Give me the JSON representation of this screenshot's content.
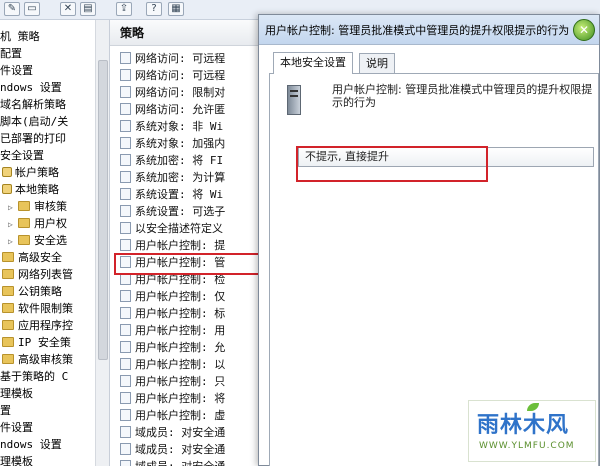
{
  "toolbar": {
    "icons": [
      "edit-icon",
      "document-icon",
      "delete-icon",
      "properties-icon",
      "export-icon",
      "help-icon",
      "view-icon"
    ]
  },
  "tree": {
    "items": [
      {
        "label": "机 策略",
        "type": "text"
      },
      {
        "label": "配置",
        "type": "text"
      },
      {
        "label": "件设置",
        "type": "text"
      },
      {
        "label": "ndows 设置",
        "type": "text"
      },
      {
        "label": "域名解析策略",
        "type": "text"
      },
      {
        "label": "脚本(启动/关",
        "type": "text"
      },
      {
        "label": "已部署的打印",
        "type": "text"
      },
      {
        "label": "安全设置",
        "type": "text"
      },
      {
        "label": "帐户策略",
        "type": "lock"
      },
      {
        "label": "本地策略",
        "type": "lock"
      },
      {
        "label": "审核策",
        "type": "folder-arrow"
      },
      {
        "label": "用户权",
        "type": "folder-arrow"
      },
      {
        "label": "安全选",
        "type": "folder-arrow"
      },
      {
        "label": "高级安全",
        "type": "folder"
      },
      {
        "label": "网络列表管",
        "type": "folder"
      },
      {
        "label": "公钥策略",
        "type": "folder"
      },
      {
        "label": "软件限制策",
        "type": "folder"
      },
      {
        "label": "应用程序控",
        "type": "folder"
      },
      {
        "label": "IP 安全策",
        "type": "folder"
      },
      {
        "label": "高级审核策",
        "type": "folder"
      },
      {
        "label": "基于策略的 C",
        "type": "text"
      },
      {
        "label": "理模板",
        "type": "text"
      },
      {
        "label": "置",
        "type": "text"
      },
      {
        "label": "件设置",
        "type": "text"
      },
      {
        "label": "ndows 设置",
        "type": "text"
      },
      {
        "label": "理模板",
        "type": "text"
      }
    ]
  },
  "policy_list": {
    "header": "策略",
    "rows": [
      "网络访问: 可远程",
      "网络访问: 可远程",
      "网络访问: 限制对",
      "网络访问: 允许匿",
      "系统对象: 非 Wi",
      "系统对象: 加强内",
      "系统加密: 将 FI",
      "系统加密: 为计算",
      "系统设置: 将 Wi",
      "系统设置: 可选子",
      "以安全描述符定义",
      "用户帐户控制: 提",
      "用户帐户控制: 管",
      "用户帐户控制: 检",
      "用户帐户控制: 仅",
      "用户帐户控制: 标",
      "用户帐户控制: 用",
      "用户帐户控制: 允",
      "用户帐户控制: 以",
      "用户帐户控制: 只",
      "用户帐户控制: 将",
      "用户帐户控制: 虚",
      "域成员: 对安全通",
      "域成员: 对安全通",
      "域成员: 对安全通"
    ]
  },
  "dialog": {
    "title": "用户帐户控制: 管理员批准模式中管理员的提升权限提示的行为",
    "tabs": [
      "本地安全设置",
      "说明"
    ],
    "policy_name": "用户帐户控制: 管理员批准模式中管理员的提升权限提示的行为",
    "selected_value": "不提示, 直接提升"
  },
  "watermark": {
    "name": "雨林木风",
    "url": "WWW.YLMFU.COM"
  }
}
